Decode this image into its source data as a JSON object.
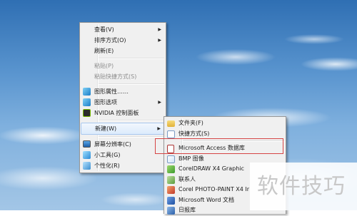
{
  "context_menu": {
    "items": [
      {
        "label": "查看(V)",
        "has_submenu": true
      },
      {
        "label": "排序方式(O)",
        "has_submenu": true
      },
      {
        "label": "刷新(E)"
      },
      {
        "label": "粘贴(P)",
        "disabled": true
      },
      {
        "label": "粘贴快捷方式(S)",
        "disabled": true
      },
      {
        "label": "图形属性……",
        "icon": "graphics-properties-icon"
      },
      {
        "label": "图形选项",
        "icon": "graphics-options-icon",
        "has_submenu": true
      },
      {
        "label": "NVIDIA 控制面板",
        "icon": "nvidia-icon"
      },
      {
        "label": "新建(W)",
        "has_submenu": true,
        "state": "hover"
      },
      {
        "label": "屏幕分辨率(C)",
        "icon": "screen-resolution-icon"
      },
      {
        "label": "小工具(G)",
        "icon": "gadgets-icon"
      },
      {
        "label": "个性化(R)",
        "icon": "personalize-icon"
      }
    ]
  },
  "new_submenu": {
    "items": [
      {
        "label": "文件夹(F)",
        "icon": "folder-icon"
      },
      {
        "label": "快捷方式(S)",
        "icon": "shortcut-icon"
      },
      {
        "label": "Microsoft Access 数据库",
        "icon": "access-icon",
        "highlighted": true
      },
      {
        "label": "BMP 图像",
        "icon": "bmp-icon"
      },
      {
        "label": "CorelDRAW X4 Graphic",
        "icon": "coreldraw-icon"
      },
      {
        "label": "联系人",
        "icon": "contact-icon"
      },
      {
        "label": "Corel PHOTO-PAINT X4 Ir",
        "icon": "photopaint-icon"
      },
      {
        "label": "Microsoft Word 文档",
        "icon": "word-icon"
      },
      {
        "label": "日报库",
        "icon": "journal-icon"
      }
    ]
  },
  "watermark": {
    "text": "软件技巧"
  },
  "colors": {
    "highlight_border": "#d64545",
    "hover_border": "#a9c8ef",
    "menu_bg": "#f0f0f0"
  }
}
